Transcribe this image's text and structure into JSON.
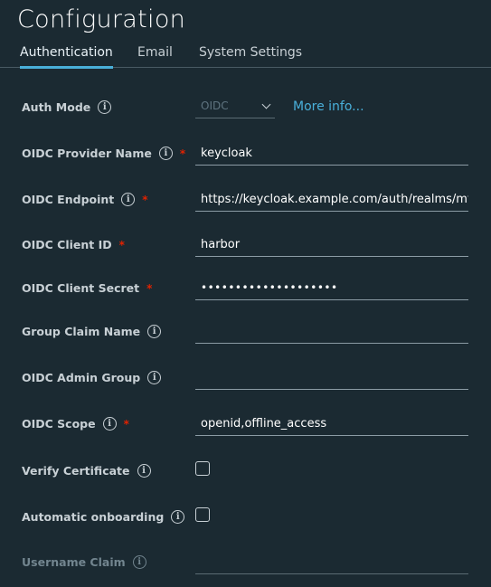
{
  "page": {
    "title": "Configuration"
  },
  "tabs": [
    {
      "label": "Authentication",
      "active": true
    },
    {
      "label": "Email",
      "active": false
    },
    {
      "label": "System Settings",
      "active": false
    }
  ],
  "colors": {
    "accent": "#49afd9",
    "required": "#e12200",
    "background": "#1b2a32"
  },
  "form": {
    "auth_mode": {
      "label": "Auth Mode",
      "value": "OIDC",
      "more_info": "More info..."
    },
    "oidc_provider_name": {
      "label": "OIDC Provider Name",
      "value": "keycloak",
      "required": "*"
    },
    "oidc_endpoint": {
      "label": "OIDC Endpoint",
      "value": "https://keycloak.example.com/auth/realms/my",
      "required": "*"
    },
    "oidc_client_id": {
      "label": "OIDC Client ID",
      "value": "harbor",
      "required": "*"
    },
    "oidc_client_secret": {
      "label": "OIDC Client Secret",
      "value": "••••••••••••••••••••",
      "required": "*"
    },
    "group_claim_name": {
      "label": "Group Claim Name",
      "value": ""
    },
    "oidc_admin_group": {
      "label": "OIDC Admin Group",
      "value": ""
    },
    "oidc_scope": {
      "label": "OIDC Scope",
      "value": "openid,offline_access",
      "required": "*"
    },
    "verify_certificate": {
      "label": "Verify Certificate",
      "checked": false
    },
    "automatic_onboarding": {
      "label": "Automatic onboarding",
      "checked": false
    },
    "username_claim": {
      "label": "Username Claim",
      "value": ""
    }
  },
  "icons": {
    "info": "i"
  }
}
